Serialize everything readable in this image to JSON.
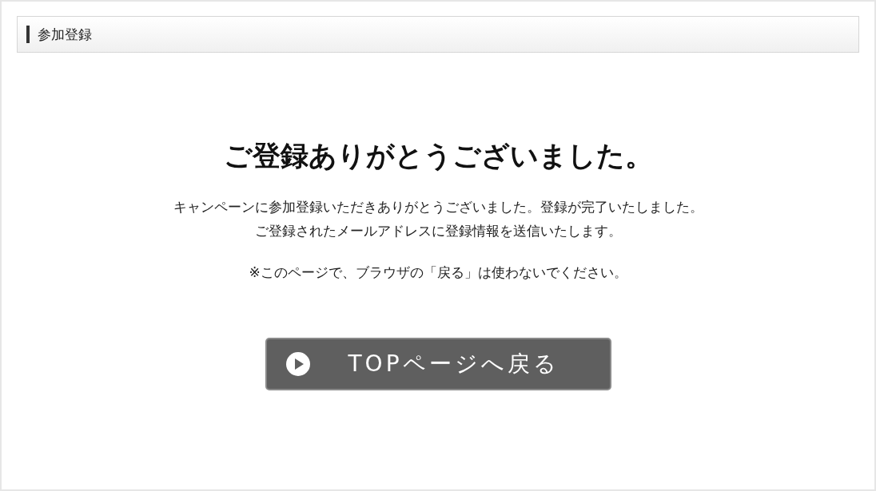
{
  "section_header": {
    "title": "参加登録"
  },
  "heading": "ご登録ありがとうございました。",
  "message_lines": [
    "キャンペーンに参加登録いただきありがとうございました。登録が完了いたしました。",
    "ご登録されたメールアドレスに登録情報を送信いたします。"
  ],
  "notice": "※このページで、ブラウザの「戻る」は使わないでください。",
  "button": {
    "label": "TOPページへ戻る"
  }
}
